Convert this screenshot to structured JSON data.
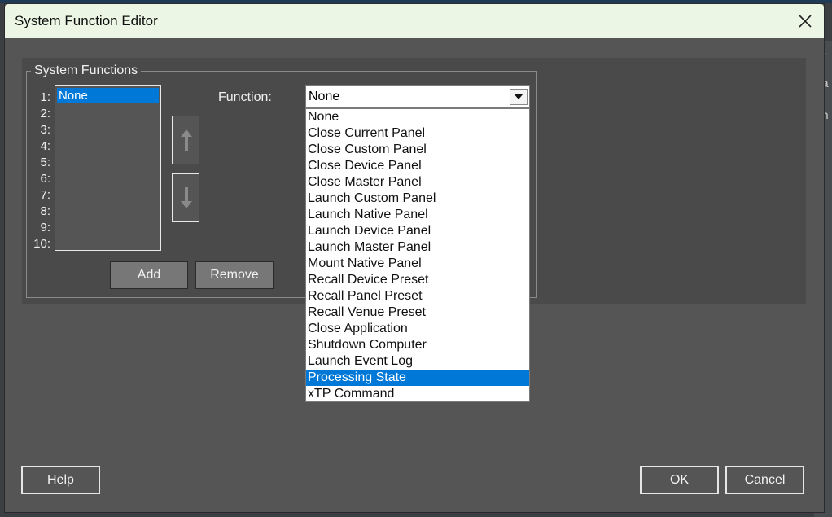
{
  "window": {
    "title": "System Function Editor"
  },
  "group": {
    "legend": "System Functions"
  },
  "slots": {
    "numbers": [
      "1:",
      "2:",
      "3:",
      "4:",
      "5:",
      "6:",
      "7:",
      "8:",
      "9:",
      "10:"
    ],
    "selected_value": "None"
  },
  "function": {
    "label": "Function:",
    "selected": "None",
    "options": [
      "None",
      "Close Current Panel",
      "Close Custom Panel",
      "Close Device Panel",
      "Close Master Panel",
      "Launch Custom Panel",
      "Launch Native Panel",
      "Launch Device Panel",
      "Launch Master Panel",
      "Mount Native Panel",
      "Recall Device Preset",
      "Recall Panel Preset",
      "Recall Venue Preset",
      "Close Application",
      "Shutdown Computer",
      "Launch Event Log",
      "Processing State",
      "xTP Command"
    ],
    "highlighted_option": "Processing State"
  },
  "buttons": {
    "add": "Add",
    "remove": "Remove",
    "help": "Help",
    "ok": "OK",
    "cancel": "Cancel"
  },
  "background": {
    "fragments": [
      "er",
      "ea",
      "en"
    ]
  },
  "colors": {
    "accent": "#0078d7",
    "title_bar": "#ecf6e4",
    "dialog": "#555555"
  },
  "icons": {
    "close": "close-icon",
    "move_up": "arrow-up-icon",
    "move_down": "arrow-down-icon",
    "dropdown": "chevron-down-icon"
  }
}
